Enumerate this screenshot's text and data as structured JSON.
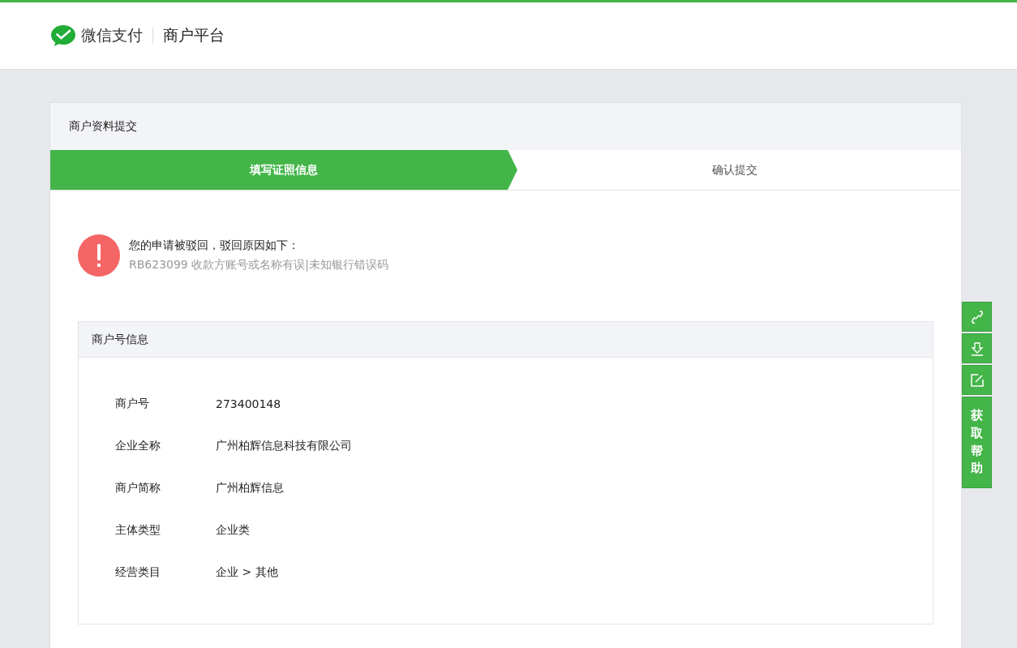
{
  "header": {
    "brand": "微信支付",
    "product": "商户平台"
  },
  "card": {
    "title": "商户资料提交",
    "steps": [
      {
        "label": "填写证照信息",
        "selected": true
      },
      {
        "label": "确认提交",
        "selected": false
      }
    ],
    "alert": {
      "title": "您的申请被驳回，驳回原因如下：",
      "reason": "RB623099 收款方账号或名称有误|未知银行错误码"
    },
    "panel": {
      "title": "商户号信息",
      "rows": [
        {
          "label": "商户号",
          "value": "273400148"
        },
        {
          "label": "企业全称",
          "value": "广州柏辉信息科技有限公司"
        },
        {
          "label": "商户简称",
          "value": "广州柏辉信息"
        },
        {
          "label": "主体类型",
          "value": "企业类"
        },
        {
          "label": "经营类目",
          "value": "企业 > 其他"
        }
      ]
    }
  },
  "side_toolbar": {
    "help": "获取帮助"
  }
}
